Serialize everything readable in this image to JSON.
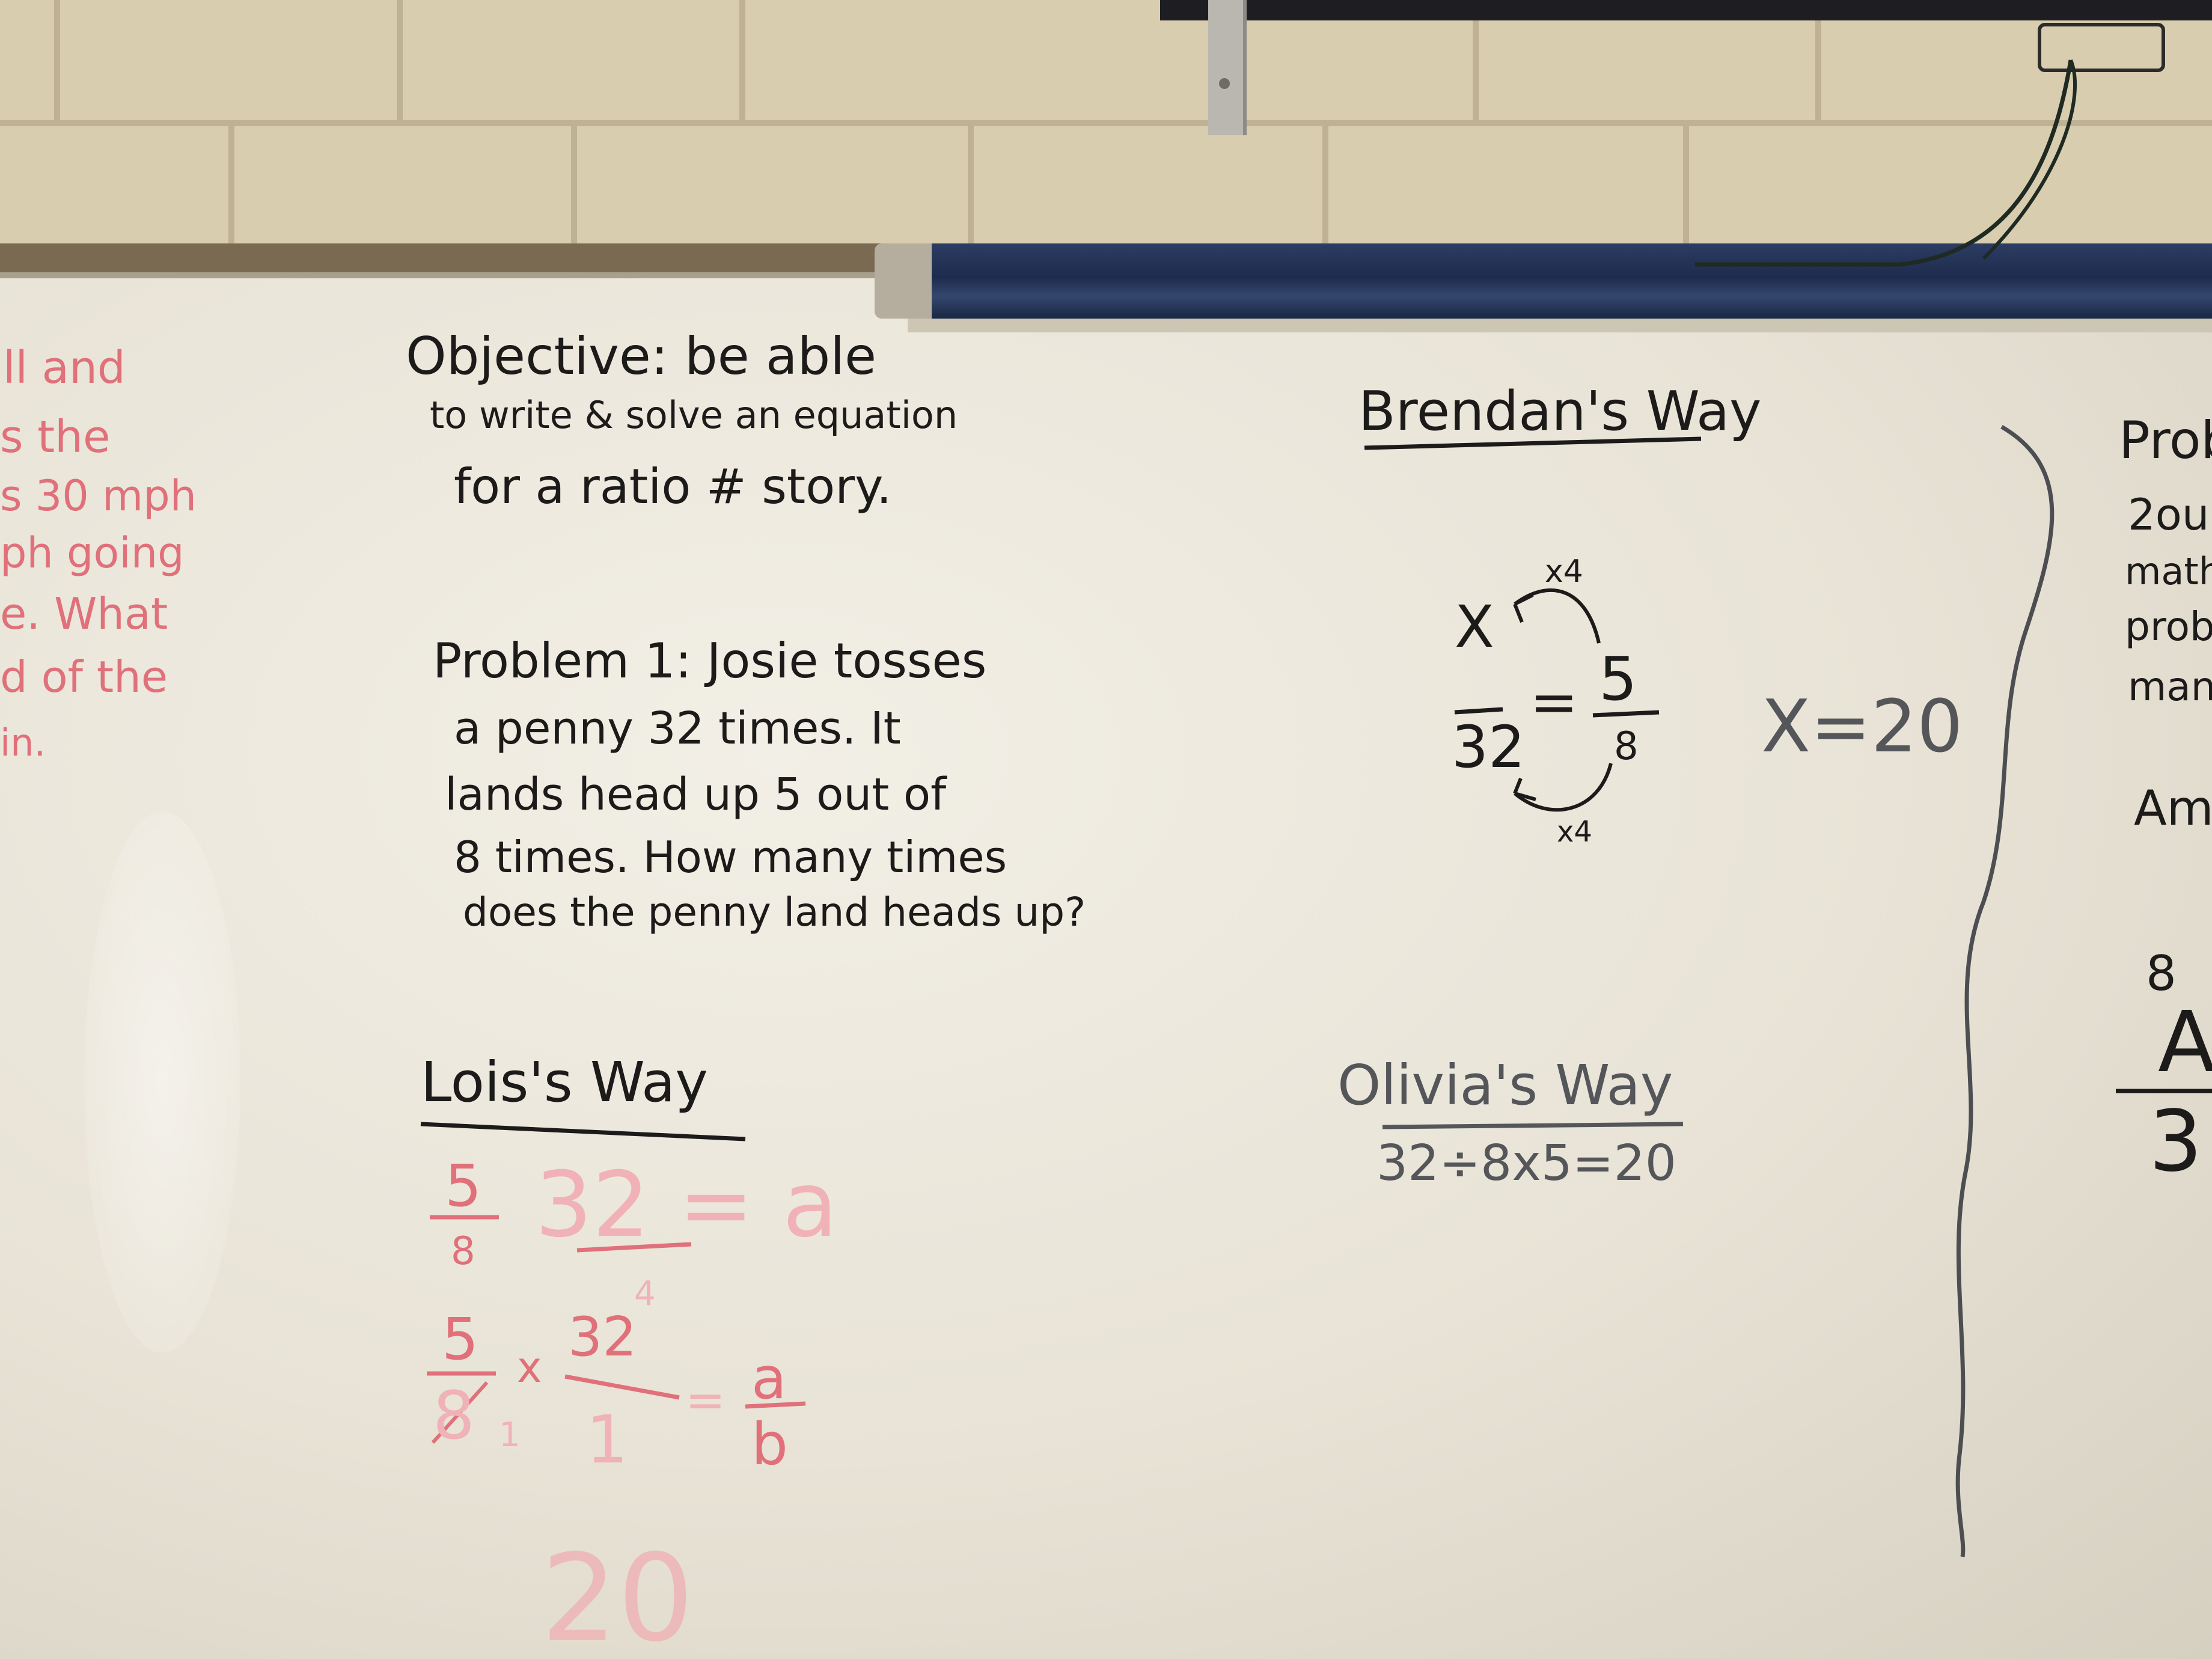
{
  "colors": {
    "marker_black": "#1c1b1a",
    "marker_red": "#e0707a",
    "marker_faded_red": "#f0b2b6",
    "marker_gray": "#55565a"
  },
  "left_edge_red_fragments": [
    "ll and",
    "s the",
    "s 30 mph",
    "ph going",
    "e. What",
    "d of the",
    "in."
  ],
  "objective": {
    "line1": "Objective: be able",
    "line2": "to write & solve an equation",
    "line3": "for a ratio # story."
  },
  "problem1": {
    "line1": "Problem 1: Josie tosses",
    "line2": "a penny 32 times. It",
    "line3": "lands head up 5 out of",
    "line4": "8 times. How many times",
    "line5": "does the penny land heads up?"
  },
  "lois": {
    "heading": "Lois's Way",
    "step1_num": "5",
    "step1_den": "8",
    "step1_rest": "32 = a",
    "step1_small": "4",
    "step2_num": "5",
    "step2_times": "x",
    "step2_mid_num": "32",
    "step2_den": "8",
    "step2_small": "1",
    "step2_mid_den": "1",
    "step2_eq": "=",
    "step2_a": "a",
    "step2_b": "b",
    "answer": "20"
  },
  "brendan": {
    "heading": "Brendan's Way",
    "top_x4": "x4",
    "bottom_x4": "x4",
    "x": "X",
    "den_left": "32",
    "eq": "=",
    "num_right": "5",
    "den_right": "8",
    "result": "X=20"
  },
  "olivia": {
    "heading": "Olivia's Way",
    "equation": "32÷8x5=20"
  },
  "right_edge_fragments": {
    "prob": "Prob",
    "line1": "2ou",
    "line2": "math",
    "line3": "prob",
    "line4": "man",
    "am": "Am",
    "num": "8",
    "a": "A",
    "den": "3"
  }
}
